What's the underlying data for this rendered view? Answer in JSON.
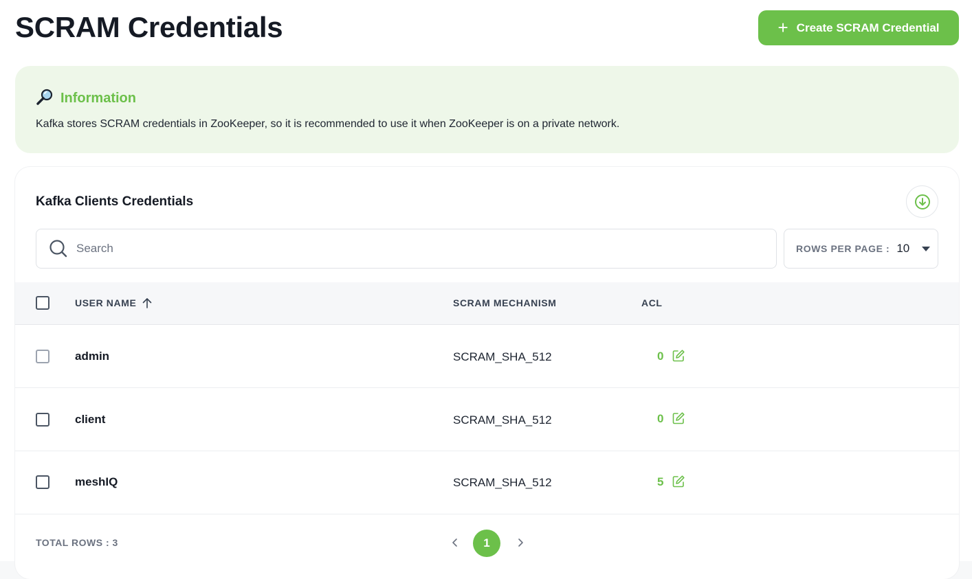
{
  "header": {
    "title": "SCRAM Credentials",
    "create_button_label": "Create SCRAM Credential"
  },
  "info": {
    "title": "Information",
    "text": "Kafka stores SCRAM credentials in ZooKeeper, so it is recommended to use it when ZooKeeper is on a private network."
  },
  "table_card": {
    "title": "Kafka Clients Credentials",
    "search_placeholder": "Search",
    "rows_per_page_label": "ROWS PER PAGE :",
    "rows_per_page_value": "10",
    "columns": {
      "user_name": "USER NAME",
      "scram_mechanism": "SCRAM MECHANISM",
      "acl": "ACL"
    },
    "sort": {
      "column": "user_name",
      "direction": "ascending"
    },
    "rows": [
      {
        "user_name": "admin",
        "scram_mechanism": "SCRAM_SHA_512",
        "acl": "0"
      },
      {
        "user_name": "client",
        "scram_mechanism": "SCRAM_SHA_512",
        "acl": "0"
      },
      {
        "user_name": "meshIQ",
        "scram_mechanism": "SCRAM_SHA_512",
        "acl": "5"
      }
    ],
    "total_rows_label": "TOTAL ROWS : 3",
    "pagination": {
      "current_page": "1"
    }
  },
  "icons": {
    "create": "plus-icon",
    "info": "magnifier-icon",
    "download": "download-circle-icon",
    "search": "search-icon",
    "rows_dropdown": "caret-down-icon",
    "sort": "arrow-up-icon",
    "acl_edit": "edit-icon",
    "prev": "chevron-left-icon",
    "next": "chevron-right-icon"
  },
  "colors": {
    "accent": "#6cc04a",
    "info_background": "#eef7e9",
    "header_background": "#f6f7f9"
  }
}
